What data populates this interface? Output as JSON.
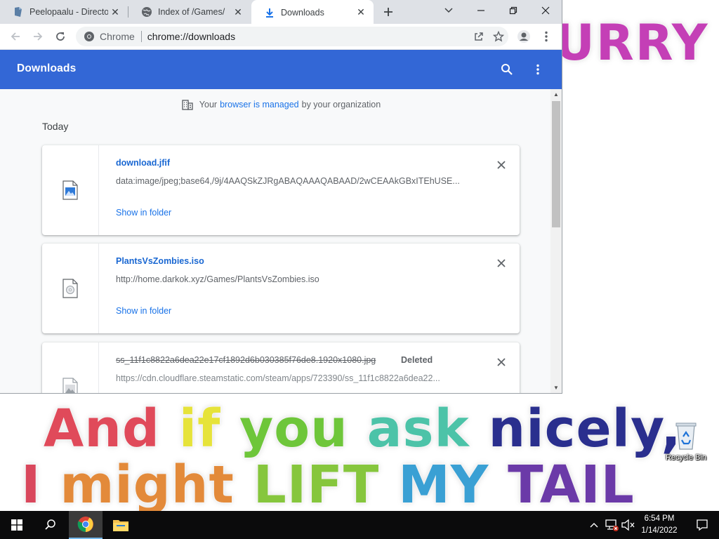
{
  "desktop": {
    "wallpaper_top": "URRY",
    "wallpaper_line1": [
      "And",
      "if",
      "you",
      "ask",
      "nicely,"
    ],
    "wallpaper_line2": [
      "I",
      "might",
      "LIFT",
      "MY",
      "TAIL"
    ],
    "recycle_bin_label": "Recycle Bin"
  },
  "browser": {
    "tabs": [
      {
        "title": "Peelopaalu - Directo",
        "icon": "page-icon",
        "active": false
      },
      {
        "title": "Index of /Games/",
        "icon": "globe-icon",
        "active": false
      },
      {
        "title": "Downloads",
        "icon": "download-icon",
        "active": true
      }
    ],
    "omnibox": {
      "site_name": "Chrome",
      "url": "chrome://downloads"
    }
  },
  "downloads_page": {
    "title": "Downloads",
    "managed_notice": {
      "prefix": "Your",
      "link": "browser is managed",
      "suffix": "by your organization"
    },
    "date_heading": "Today",
    "items": [
      {
        "file_name": "download.jfif",
        "url": "data:image/jpeg;base64,/9j/4AAQSkZJRgABAQAAAQABAAD/2wCEAAkGBxITEhUSE...",
        "action": "Show in folder",
        "status": "",
        "icon": "image-file-icon"
      },
      {
        "file_name": "PlantsVsZombies.iso",
        "url": "http://home.darkok.xyz/Games/PlantsVsZombies.iso",
        "action": "Show in folder",
        "status": "",
        "icon": "disc-image-file-icon"
      },
      {
        "file_name": "ss_11f1c8822a6dea22e17cf1892d6b030385f76de8.1920x1080.jpg",
        "url": "https://cdn.cloudflare.steamstatic.com/steam/apps/723390/ss_11f1c8822a6dea22...",
        "action": "",
        "status": "Deleted",
        "icon": "image-file-icon"
      }
    ]
  },
  "taskbar": {
    "clock_time": "6:54 PM",
    "clock_date": "1/14/2022"
  },
  "colors": {
    "downloads_header": "#3367d6",
    "link_blue": "#1a73e8",
    "tab_strip": "#dee1e6",
    "taskbar": "#0b0b0c"
  }
}
